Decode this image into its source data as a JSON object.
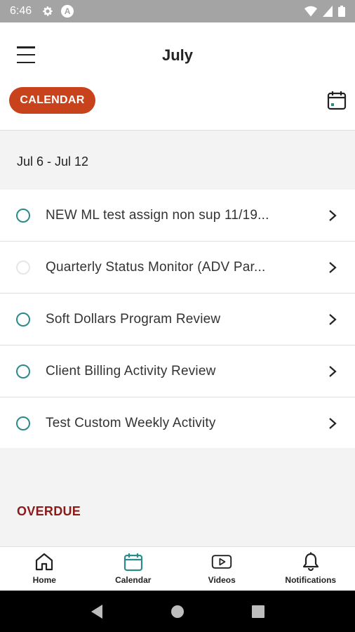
{
  "status_bar": {
    "time": "6:46",
    "badge_letter": "A"
  },
  "header": {
    "title": "July",
    "menu_icon": "hamburger-menu-icon",
    "view_chip_label": "CALENDAR",
    "view_toggle_icon": "calendar-icon"
  },
  "week": {
    "label": "Jul 6 - Jul 12"
  },
  "tasks": [
    {
      "label": "NEW ML test assign non sup 11/19...",
      "status": "open"
    },
    {
      "label": "Quarterly Status Monitor (ADV Par...",
      "status": "empty"
    },
    {
      "label": "Soft Dollars Program Review",
      "status": "open"
    },
    {
      "label": "Client Billing Activity Review",
      "status": "open"
    },
    {
      "label": "Test Custom Weekly Activity",
      "status": "open"
    }
  ],
  "overdue": {
    "label": "OVERDUE"
  },
  "bottom_nav": {
    "items": [
      {
        "label": "Home",
        "icon": "home-icon"
      },
      {
        "label": "Calendar",
        "icon": "calendar-icon",
        "active": true
      },
      {
        "label": "Videos",
        "icon": "video-play-icon"
      },
      {
        "label": "Notifications",
        "icon": "bell-icon"
      }
    ]
  },
  "colors": {
    "accent": "#c8421b",
    "teal": "#2c8a8a",
    "overdue": "#8b1a1a",
    "status_bar": "#a4a4a4"
  }
}
